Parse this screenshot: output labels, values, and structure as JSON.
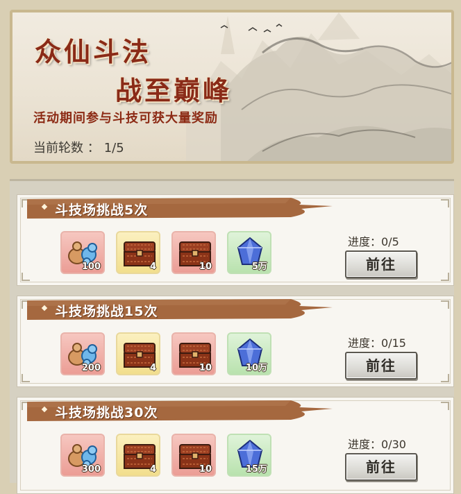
{
  "banner": {
    "title_line1": "众仙斗法",
    "title_line2": "战至巅峰",
    "subtitle": "活动期间参与斗技可获大量奖励",
    "round_label": "当前轮数 ：",
    "round_value": "1/5"
  },
  "tasks": [
    {
      "title": "斗技场挑战5次",
      "progress": "进度：0/5",
      "button": "前往",
      "rewards": [
        {
          "icon": "gourd-flower-icon",
          "count": "100",
          "bg": "pink"
        },
        {
          "icon": "treasure-chest-icon",
          "count": "4",
          "bg": "yellow"
        },
        {
          "icon": "treasure-chest-icon",
          "count": "10",
          "bg": "pink"
        },
        {
          "icon": "spirit-crystal-icon",
          "count": "5万",
          "bg": "green"
        }
      ]
    },
    {
      "title": "斗技场挑战15次",
      "progress": "进度：0/15",
      "button": "前往",
      "rewards": [
        {
          "icon": "gourd-flower-icon",
          "count": "200",
          "bg": "pink"
        },
        {
          "icon": "treasure-chest-icon",
          "count": "4",
          "bg": "yellow"
        },
        {
          "icon": "treasure-chest-icon",
          "count": "10",
          "bg": "pink"
        },
        {
          "icon": "spirit-crystal-icon",
          "count": "10万",
          "bg": "green"
        }
      ]
    },
    {
      "title": "斗技场挑战30次",
      "progress": "进度：0/30",
      "button": "前往",
      "rewards": [
        {
          "icon": "gourd-flower-icon",
          "count": "300",
          "bg": "pink"
        },
        {
          "icon": "treasure-chest-icon",
          "count": "4",
          "bg": "yellow"
        },
        {
          "icon": "treasure-chest-icon",
          "count": "10",
          "bg": "pink"
        },
        {
          "icon": "spirit-crystal-icon",
          "count": "15万",
          "bg": "green"
        }
      ]
    }
  ],
  "colors": {
    "title_red": "#8a2a17",
    "header_brush": "#a5683f",
    "button_gray": "#dcdbd6"
  }
}
